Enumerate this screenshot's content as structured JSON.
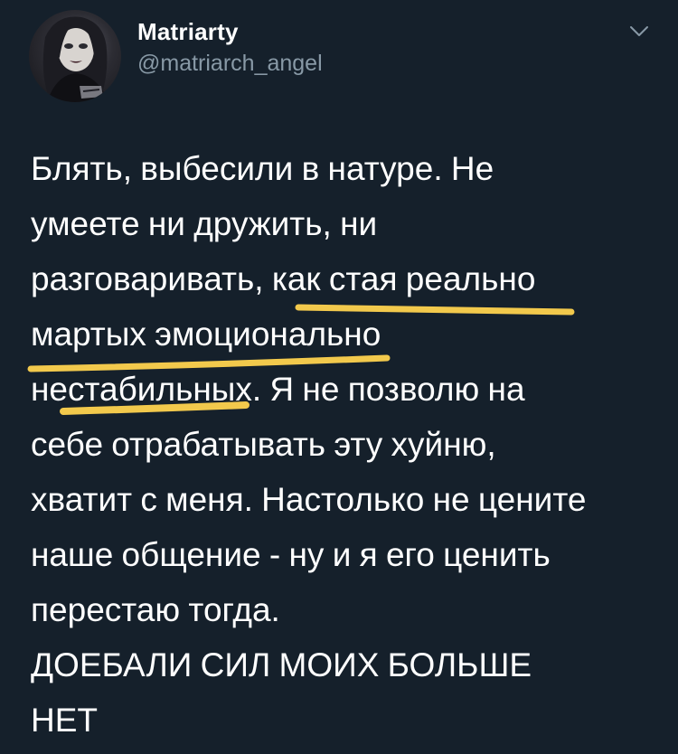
{
  "tweet": {
    "author": {
      "display_name": "Matriarty",
      "handle": "@matriarch_angel",
      "avatar_icon": "profile-photo"
    },
    "menu_icon": "chevron-down-icon",
    "text_lines": [
      "Блять, выбесили в натуре. Не",
      "умеете ни дружить, ни",
      "разговаривать, как стая реально",
      "мартых эмоционально",
      "нестабильных. Я не позволю на",
      "себе отрабатывать эту хуйню,",
      "хватит с меня. Настолько не цените",
      "наше общение - ну и я его ценить",
      "перестаю тогда.",
      "ДОЕБАЛИ СИЛ МОИХ БОЛЬШЕ",
      "НЕТ"
    ],
    "colors": {
      "background": "#15202b",
      "text": "#ffffff",
      "secondary_text": "#8899a6",
      "highlight": "#f2c94c"
    }
  }
}
